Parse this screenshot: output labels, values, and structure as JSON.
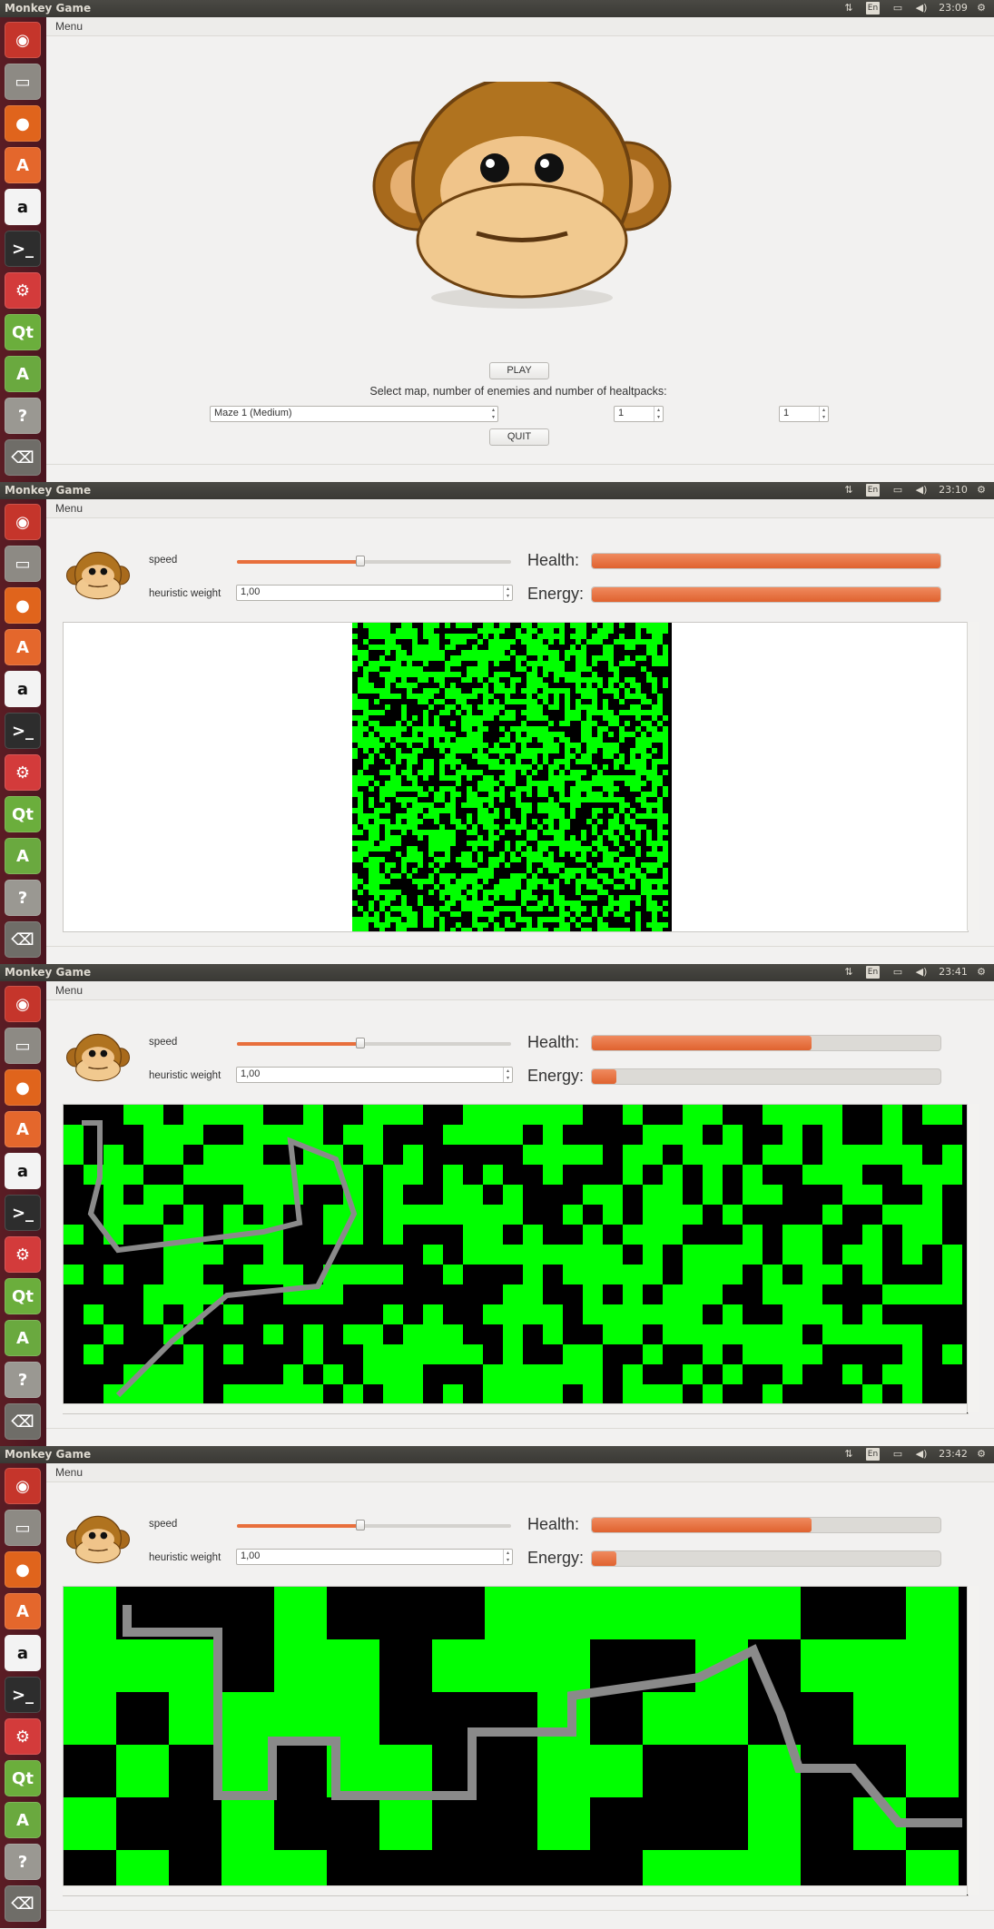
{
  "app": {
    "title": "Monkey Game",
    "menu_label": "Menu"
  },
  "top_bar": {
    "keyboard_layout": "En"
  },
  "launcher": {
    "items": [
      {
        "icon": "ubuntu-dash-icon",
        "color": "#c5352b",
        "glyph": "◉"
      },
      {
        "icon": "files-icon",
        "color": "#8d8a84",
        "glyph": "▭"
      },
      {
        "icon": "firefox-icon",
        "color": "#e0641c",
        "glyph": "●"
      },
      {
        "icon": "software-center-icon",
        "color": "#e4672c",
        "glyph": "A"
      },
      {
        "icon": "amazon-icon",
        "color": "#f3f3f3",
        "glyph": "a"
      },
      {
        "icon": "terminal-icon",
        "color": "#2d2d2d",
        "glyph": ">_"
      },
      {
        "icon": "system-settings-icon",
        "color": "#d33b3b",
        "glyph": "⚙"
      },
      {
        "icon": "qt-creator-icon",
        "color": "#6bae3c",
        "glyph": "Qt"
      },
      {
        "icon": "software-updater-icon",
        "color": "#6aa93f",
        "glyph": "A"
      },
      {
        "icon": "unknown-app-icon",
        "color": "#9a9892",
        "glyph": "?"
      },
      {
        "icon": "trash-icon",
        "color": "#6f6d68",
        "glyph": "⌫"
      }
    ]
  },
  "screens": [
    {
      "clock": "23:09",
      "main_menu": {
        "play_label": "PLAY",
        "instruction": "Select  map,  number of enemies  and  number of healtpacks:",
        "map_selected": "Maze 1 (Medium)",
        "enemies_value": "1",
        "healthpacks_value": "1",
        "quit_label": "QUIT"
      }
    },
    {
      "clock": "23:10",
      "controls": {
        "speed_label": "speed",
        "speed_level": 0.45,
        "heuristic_label": "heuristic weight",
        "heuristic_value": "1,00",
        "health_label": "Health:",
        "health_level": 1.0,
        "energy_label": "Energy:",
        "energy_level": 1.0
      }
    },
    {
      "clock": "23:41",
      "controls": {
        "speed_label": "speed",
        "speed_level": 0.45,
        "heuristic_label": "heuristic weight",
        "heuristic_value": "1,00",
        "health_label": "Health:",
        "health_level": 0.63,
        "energy_label": "Energy:",
        "energy_level": 0.07
      }
    },
    {
      "clock": "23:42",
      "controls": {
        "speed_label": "speed",
        "speed_level": 0.45,
        "heuristic_label": "heuristic weight",
        "heuristic_value": "1,00",
        "health_label": "Health:",
        "health_level": 0.63,
        "energy_label": "Energy:",
        "energy_level": 0.07
      }
    }
  ],
  "colors": {
    "accent": "#e86f3c",
    "maze_path": "#00ff00",
    "maze_wall": "#000000",
    "trail": "#8a8a8a",
    "launcher": "#521a22"
  }
}
